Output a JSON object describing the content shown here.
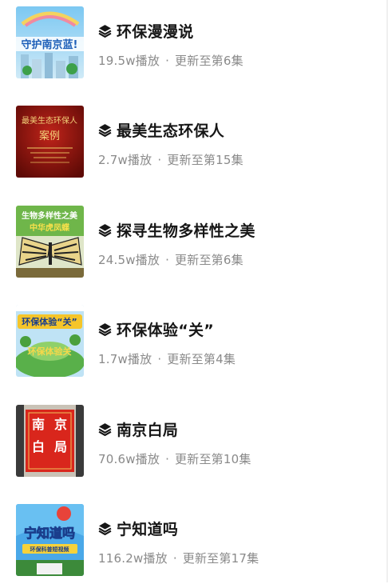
{
  "series": [
    {
      "title": "环保漫漫说",
      "plays": "19.5w播放",
      "separator": "·",
      "update": "更新至第6集",
      "thumb_text": "守护南京蓝!",
      "thumb_top_text": "守护南京蓝",
      "icon": "stack-icon"
    },
    {
      "title": "最美生态环保人",
      "plays": "2.7w播放",
      "separator": "·",
      "update": "更新至第15集",
      "thumb_text": "最美生态环保人",
      "thumb_sub_text": "案例",
      "icon": "stack-icon"
    },
    {
      "title": "探寻生物多样性之美",
      "plays": "24.5w播放",
      "separator": "·",
      "update": "更新至第6集",
      "thumb_text": "生物多样性之美",
      "thumb_sub_text": "中华虎凤蝶",
      "icon": "stack-icon"
    },
    {
      "title": "环保体验“关”",
      "plays": "1.7w播放",
      "separator": "·",
      "update": "更新至第4集",
      "thumb_text": "环保体验“关”",
      "thumb_sub_text": "环保体验关",
      "icon": "stack-icon"
    },
    {
      "title": "南京白局",
      "plays": "70.6w播放",
      "separator": "·",
      "update": "更新至第10集",
      "thumb_chars": [
        "南",
        "京",
        "白",
        "局"
      ],
      "icon": "stack-icon"
    },
    {
      "title": "宁知道吗",
      "plays": "116.2w播放",
      "separator": "·",
      "update": "更新至第17集",
      "thumb_text": "宁知道吗",
      "thumb_sub_text": "环保科普短视频",
      "icon": "stack-icon"
    }
  ],
  "colors": {
    "title": "#161616",
    "meta": "#8a8a8a",
    "background": "#ffffff"
  }
}
